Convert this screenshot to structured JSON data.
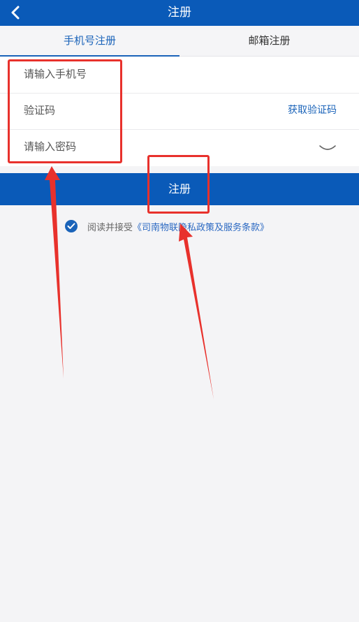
{
  "header": {
    "title": "注册"
  },
  "tabs": [
    {
      "label": "手机号注册",
      "active": true
    },
    {
      "label": "邮箱注册",
      "active": false
    }
  ],
  "form": {
    "phone": {
      "placeholder": "请输入手机号",
      "value": ""
    },
    "code": {
      "placeholder": "验证码",
      "value": "",
      "get_code_label": "获取验证码"
    },
    "password": {
      "placeholder": "请输入密码",
      "value": ""
    }
  },
  "submit_label": "注册",
  "agreement": {
    "checked": true,
    "prefix": "阅读并接受",
    "link_text": "《司南物联隐私政策及服务条款》"
  },
  "colors": {
    "primary": "#0a5ab8",
    "tab_active": "#1a63b9",
    "link": "#2a68c2",
    "annotation_red": "#e8312c"
  }
}
